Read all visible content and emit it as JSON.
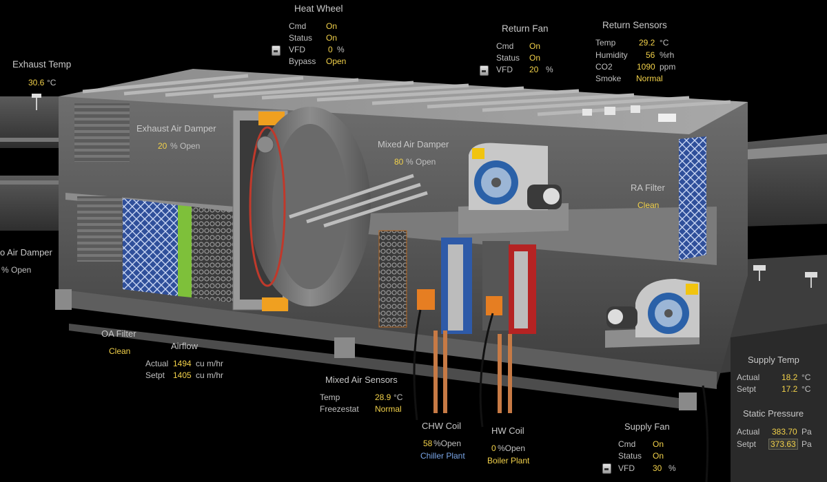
{
  "heat_wheel": {
    "title": "Heat Wheel",
    "cmd_label": "Cmd",
    "cmd": "On",
    "status_label": "Status",
    "status": "On",
    "vfd_label": "VFD",
    "vfd": "0",
    "vfd_unit": "%",
    "bypass_label": "Bypass",
    "bypass": "Open"
  },
  "return_fan": {
    "title": "Return Fan",
    "cmd_label": "Cmd",
    "cmd": "On",
    "status_label": "Status",
    "status": "On",
    "vfd_label": "VFD",
    "vfd": "20",
    "vfd_unit": "%"
  },
  "return_sensors": {
    "title": "Return Sensors",
    "temp_label": "Temp",
    "temp": "29.2",
    "temp_unit": "°C",
    "hum_label": "Humidity",
    "hum": "56",
    "hum_unit": "%rh",
    "co2_label": "CO2",
    "co2": "1090",
    "co2_unit": "ppm",
    "smoke_label": "Smoke",
    "smoke": "Normal"
  },
  "exhaust_temp": {
    "title": "Exhaust Temp",
    "value": "30.6",
    "unit": "°C"
  },
  "exhaust_damper": {
    "title": "Exhaust Air Damper",
    "value": "20",
    "unit": "% Open"
  },
  "mixed_damper": {
    "title": "Mixed Air Damper",
    "value": "80",
    "unit": "% Open"
  },
  "oa_damper": {
    "title": "o Air Damper",
    "unit": "% Open"
  },
  "ra_filter": {
    "title": "RA Filter",
    "status": "Clean"
  },
  "oa_filter": {
    "title": "OA Filter",
    "status": "Clean"
  },
  "airflow": {
    "title": "Airflow",
    "actual_label": "Actual",
    "actual": "1494",
    "actual_unit": "cu m/hr",
    "setpt_label": "Setpt",
    "setpt": "1405",
    "setpt_unit": "cu m/hr"
  },
  "mixed_sensors": {
    "title": "Mixed Air Sensors",
    "temp_label": "Temp",
    "temp": "28.9",
    "temp_unit": "°C",
    "freeze_label": "Freezestat",
    "freeze": "Normal"
  },
  "chw_coil": {
    "title": "CHW Coil",
    "value": "58",
    "unit": "%Open",
    "plant": "Chiller Plant"
  },
  "hw_coil": {
    "title": "HW Coil",
    "value": "0",
    "unit": "%Open",
    "plant": "Boiler Plant"
  },
  "supply_fan": {
    "title": "Supply Fan",
    "cmd_label": "Cmd",
    "cmd": "On",
    "status_label": "Status",
    "status": "On",
    "vfd_label": "VFD",
    "vfd": "30",
    "vfd_unit": "%"
  },
  "supply_temp": {
    "title": "Supply Temp",
    "actual_label": "Actual",
    "actual": "18.2",
    "unit": "°C",
    "setpt_label": "Setpt",
    "setpt": "17.2"
  },
  "static_pressure": {
    "title": "Static Pressure",
    "actual_label": "Actual",
    "actual": "383.70",
    "unit": "Pa",
    "setpt_label": "Setpt",
    "setpt": "373.63"
  }
}
